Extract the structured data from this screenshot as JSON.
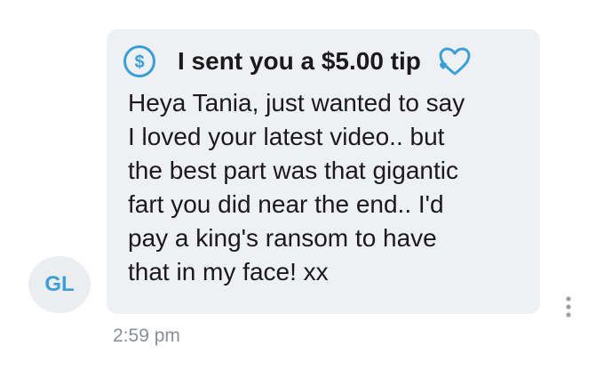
{
  "avatar": {
    "initials": "GL",
    "color": "#3a9fd7"
  },
  "tip": {
    "text": "I sent you a $5.00 tip",
    "leading_icon": "dollar-circle-icon",
    "trailing_icon": "heart-icon"
  },
  "message": {
    "lines": [
      "Heya Tania, just wanted to say",
      "I loved your latest video.. but",
      "the best part was that gigantic",
      "fart you did near the end.. I'd",
      "pay a king's ransom to have",
      "that in my face! xx"
    ]
  },
  "timestamp": "2:59 pm",
  "actions": {
    "more_icon": "more-vertical-icon"
  },
  "colors": {
    "bubble": "#eef0f3",
    "avatar_bg": "#ebedf0",
    "accent": "#3a9fd7",
    "text": "#1a1a1a",
    "meta": "#8a8f96"
  }
}
